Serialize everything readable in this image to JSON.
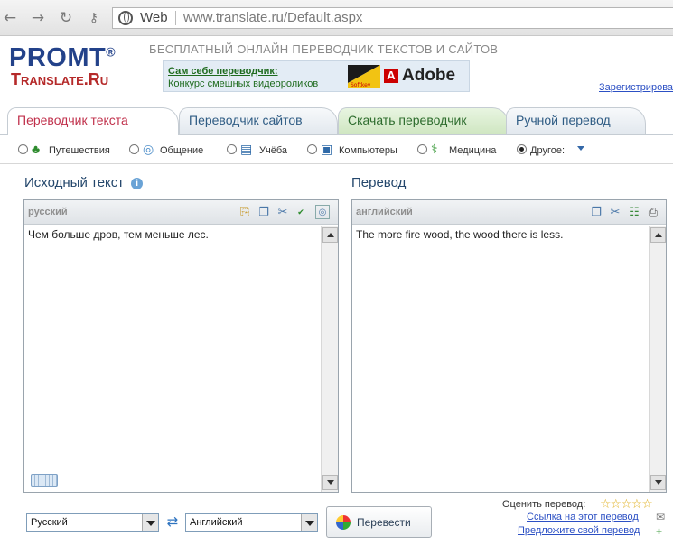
{
  "browser": {
    "web_label": "Web",
    "url": "www.translate.ru/Default.aspx"
  },
  "header": {
    "logo_line1": "PROMT",
    "logo_reg": "®",
    "logo_line2": "Translate.Ru",
    "tagline": "БЕСПЛАТНЫЙ ОНЛАЙН ПЕРЕВОДЧИК ТЕКСТОВ И САЙТОВ",
    "ad_title": "Сам себе переводчик:",
    "ad_subtitle": "Конкурс смешных видеороликов",
    "ad_softkey": "Softkey",
    "ad_brand": "Adobe",
    "register_link": "Зарегистрироваться"
  },
  "tabs": [
    {
      "label": "Переводчик текста",
      "active": true
    },
    {
      "label": "Переводчик сайтов",
      "active": false
    },
    {
      "label": "Скачать переводчик",
      "active": false
    },
    {
      "label": "Ручной перевод",
      "active": false
    }
  ],
  "topics": [
    {
      "label": "Путешествия",
      "icon": "palm-tree-icon",
      "selected": false
    },
    {
      "label": "Общение",
      "icon": "chat-bubble-icon",
      "selected": false
    },
    {
      "label": "Учёба",
      "icon": "book-icon",
      "selected": false
    },
    {
      "label": "Компьютеры",
      "icon": "monitor-icon",
      "selected": false
    },
    {
      "label": "Медицина",
      "icon": "medicine-bowl-icon",
      "selected": false
    },
    {
      "label": "Другое:",
      "icon": "dropdown-arrow-icon",
      "selected": true
    }
  ],
  "source": {
    "title": "Исходный текст",
    "lang_tag": "русский",
    "text": "Чем больше дров, тем меньше лес."
  },
  "target": {
    "title": "Перевод",
    "lang_tag": "английский",
    "text": "The more fire wood, the wood there is less."
  },
  "controls": {
    "source_lang": "Русский",
    "target_lang": "Английский",
    "translate_button": "Перевести",
    "rate_label": "Оценить перевод:",
    "link_label": "Ссылка на этот перевод",
    "suggest_label": "Предложите свой перевод"
  },
  "colors": {
    "logo_blue": "#23428a",
    "logo_red": "#b52a2a",
    "active_tab_text": "#c0304b",
    "tab_text": "#2f5c84",
    "panel_title": "#24476c",
    "link": "#2c50c4",
    "star": "#e0b020"
  }
}
